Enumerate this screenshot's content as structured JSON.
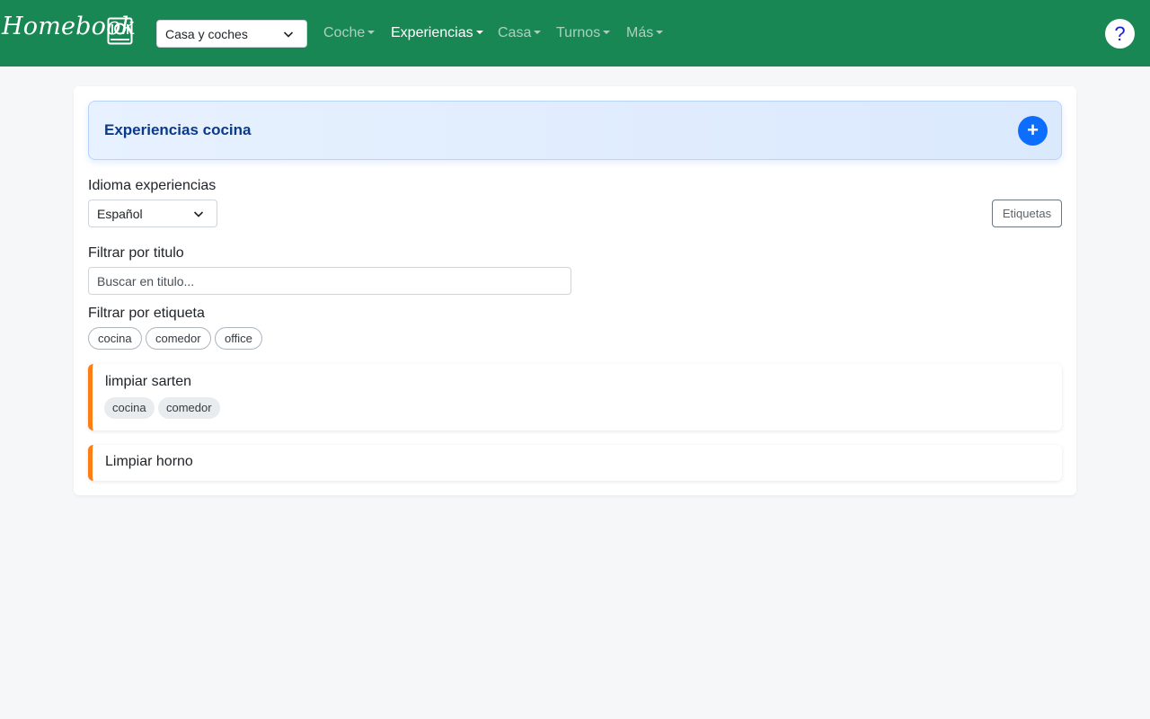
{
  "navbar": {
    "brand": "Homebook",
    "brand_icon": "kitchen-book-icon",
    "group_select": {
      "value": "Casa y coches"
    },
    "menu": [
      {
        "label": "Coche",
        "active": false
      },
      {
        "label": "Experiencias",
        "active": true
      },
      {
        "label": "Casa",
        "active": false
      },
      {
        "label": "Turnos",
        "active": false
      },
      {
        "label": "Más",
        "active": false
      }
    ],
    "help_label": "?",
    "background": "#198754"
  },
  "main": {
    "header_title": "Experiencias cocina",
    "add_label": "+",
    "language": {
      "label": "Idioma experiencias",
      "value": "Español"
    },
    "tags_button": "Etiquetas",
    "title_filter": {
      "label": "Filtrar por titulo",
      "placeholder": "Buscar en titulo..."
    },
    "tag_filter": {
      "label": "Filtrar por etiqueta",
      "tags": [
        "cocina",
        "comedor",
        "office"
      ]
    },
    "experiences": [
      {
        "title": "limpiar sarten",
        "tags": [
          "cocina",
          "comedor"
        ]
      },
      {
        "title": "Limpiar horno",
        "tags": []
      }
    ],
    "accent_color": "#fd7e14",
    "primary_color": "#0d6efd"
  }
}
